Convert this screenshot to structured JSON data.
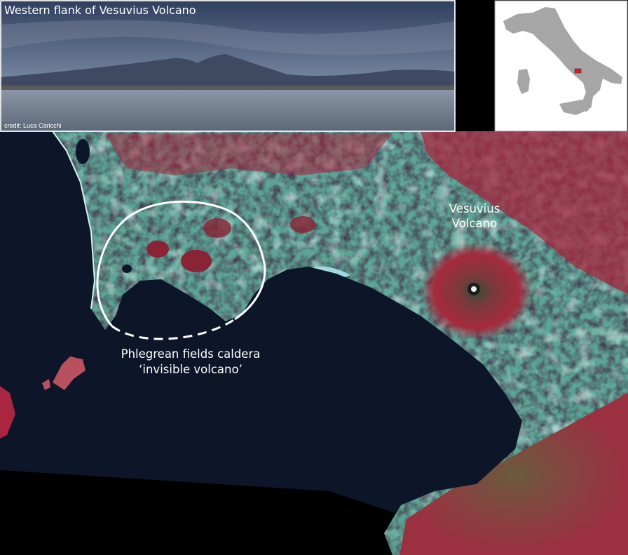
{
  "photo": {
    "title": "Western flank of Vesuvius Volcano",
    "credit": "credit: Luca Caricchi"
  },
  "map_labels": {
    "vesuvius_line1": "Vesuvius",
    "vesuvius_line2": "Volcano",
    "phlegrean_line1": "Phlegrean fields caldera",
    "phlegrean_line2": "‘invisible volcano’"
  },
  "colors": {
    "sea": "#0c1628",
    "urban": "#5da596",
    "vegetation": "#a8263f",
    "caldera_outline": "#ffffff",
    "italy_locator_fill": "#a6a6a6",
    "locator_marker": "#e0191a"
  }
}
